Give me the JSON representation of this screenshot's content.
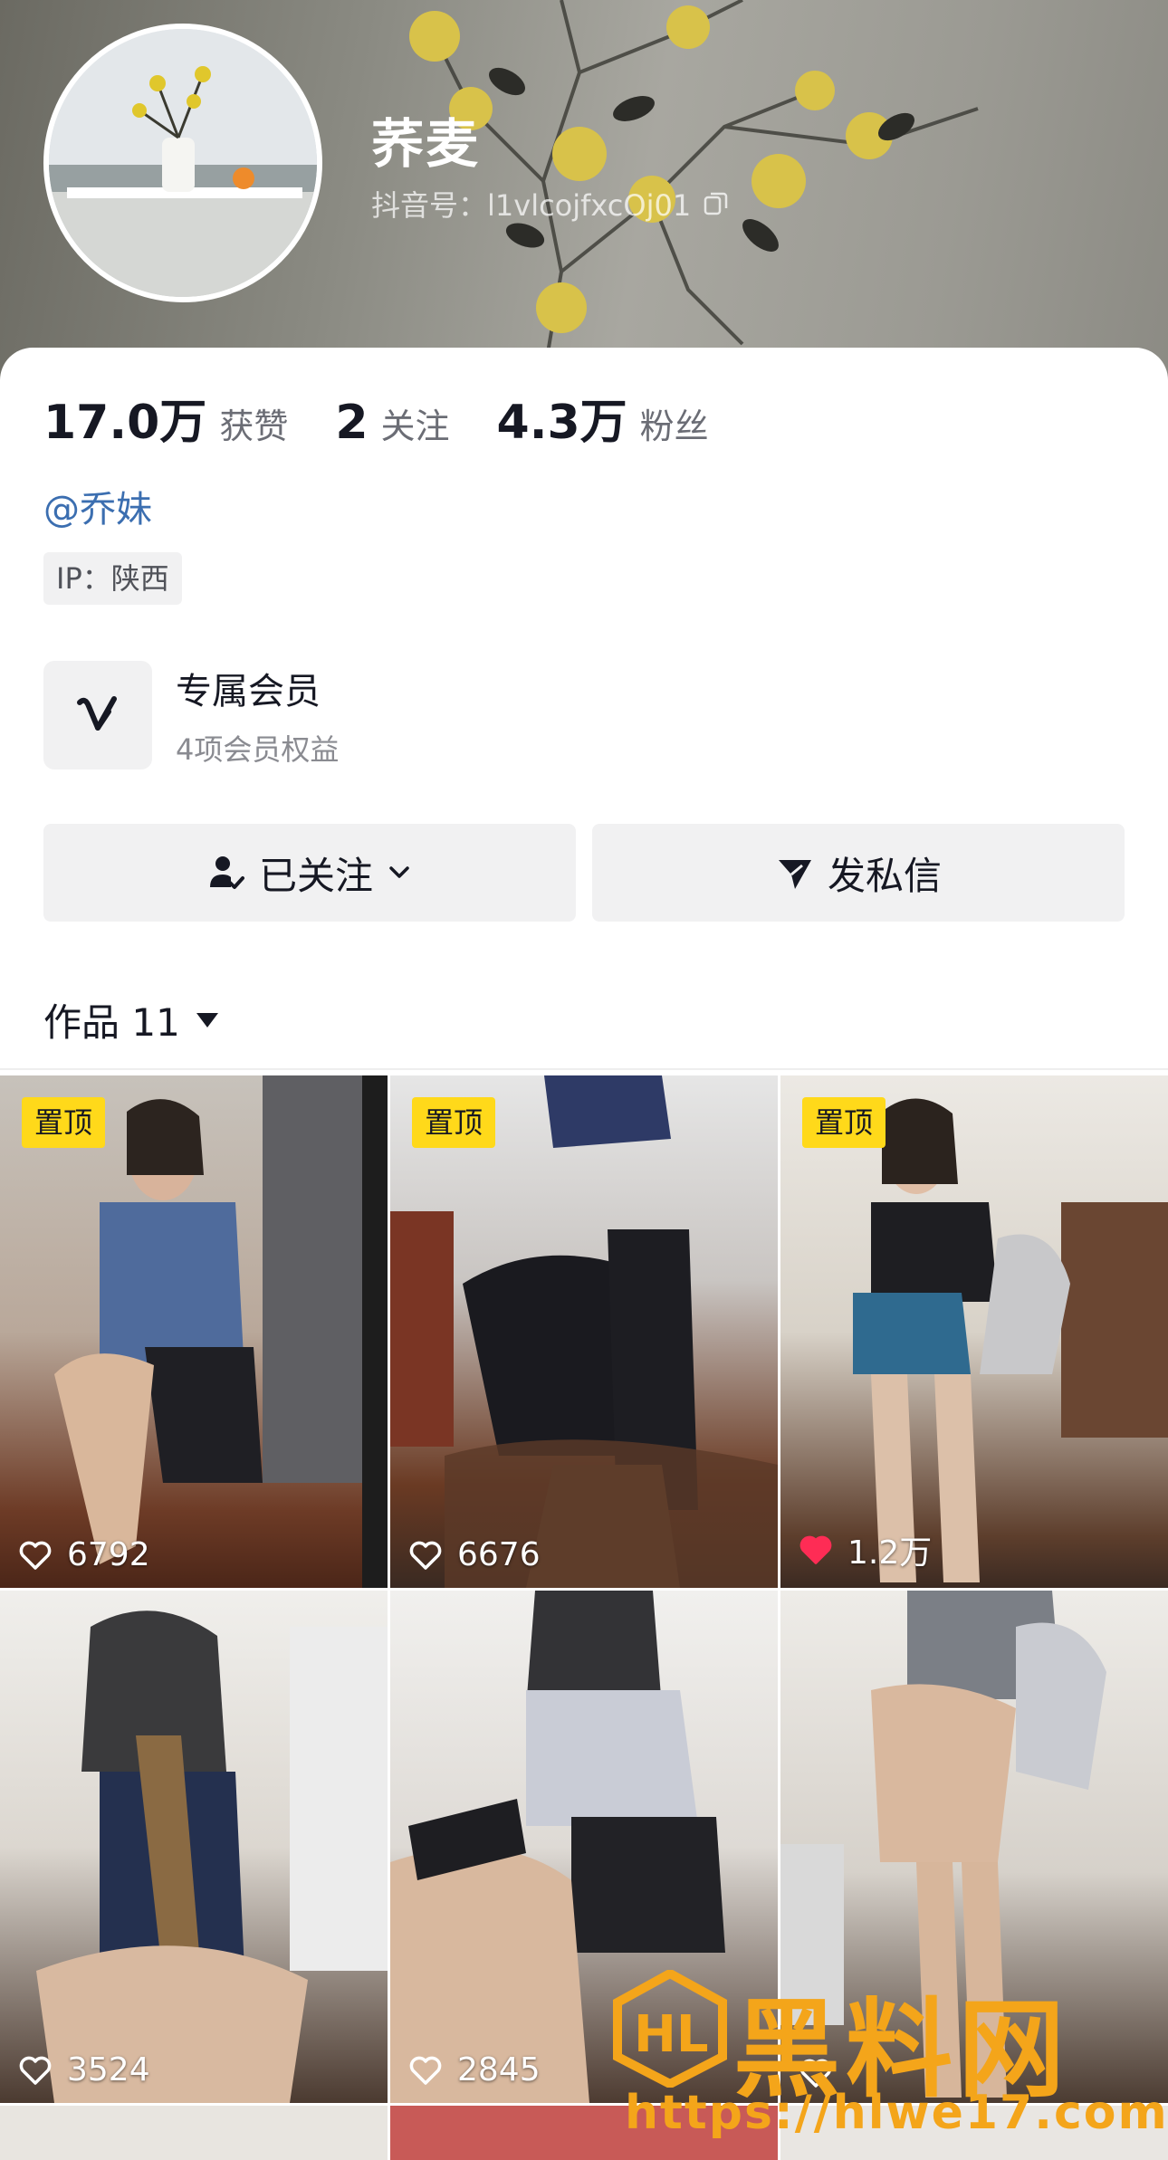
{
  "profile": {
    "nickname": "荞麦",
    "douyin_id": "抖音号：l1vlcojfxcOj01"
  },
  "stats": [
    {
      "value": "17.0万",
      "label": "获赞"
    },
    {
      "value": "2",
      "label": "关注"
    },
    {
      "value": "4.3万",
      "label": "粉丝"
    }
  ],
  "mention": "@乔妹",
  "ip_tag": "IP：陕西",
  "member": {
    "title": "专属会员",
    "subtitle": "4项会员权益"
  },
  "actions": {
    "follow_label": "已关注",
    "message_label": "发私信"
  },
  "works_tab": {
    "label": "作品 11"
  },
  "videos": [
    {
      "pinned": true,
      "pin_label": "置顶",
      "likes": "6792",
      "liked": false
    },
    {
      "pinned": true,
      "pin_label": "置顶",
      "likes": "6676",
      "liked": false
    },
    {
      "pinned": true,
      "pin_label": "置顶",
      "likes": "1.2万",
      "liked": true
    },
    {
      "pinned": false,
      "pin_label": "",
      "likes": "3524",
      "liked": false
    },
    {
      "pinned": false,
      "pin_label": "",
      "likes": "2845",
      "liked": false
    },
    {
      "pinned": false,
      "pin_label": "",
      "likes": "",
      "liked": false
    }
  ],
  "watermark": {
    "text": "黑料网",
    "url": "https://hlwe17.com"
  },
  "colors": {
    "mention": "#3b6eb0",
    "pin_badge": "#ffd91a",
    "liked_heart": "#fe2c55",
    "watermark": "#f4a51a"
  }
}
